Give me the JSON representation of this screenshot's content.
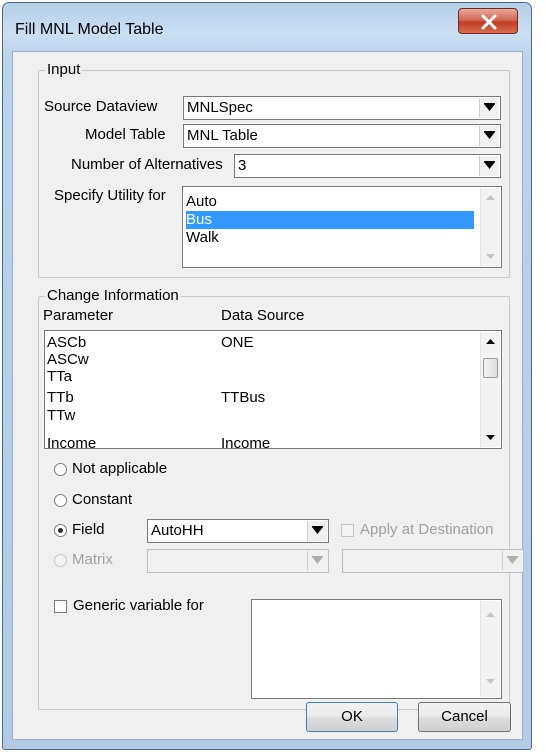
{
  "window": {
    "title": "Fill MNL Model Table",
    "close_icon": "close-icon"
  },
  "input_group": {
    "legend": "Input",
    "source_dataview": {
      "label": "Source Dataview",
      "value": "MNLSpec"
    },
    "model_table": {
      "label": "Model Table",
      "value": "MNL Table"
    },
    "num_alternatives": {
      "label": "Number of Alternatives",
      "value": "3"
    },
    "specify_utility": {
      "label": "Specify Utility for",
      "items": [
        "Auto",
        "Bus",
        "Walk"
      ],
      "selected": "Bus"
    }
  },
  "change_group": {
    "legend": "Change Information",
    "columns": {
      "parameter": "Parameter",
      "data_source": "Data Source"
    },
    "rows": [
      {
        "parameter": "ASCb",
        "data_source": "ONE"
      },
      {
        "parameter": "ASCw",
        "data_source": ""
      },
      {
        "parameter": "TTa",
        "data_source": ""
      },
      {
        "parameter": "TTb",
        "data_source": "TTBus"
      },
      {
        "parameter": "TTw",
        "data_source": ""
      },
      {
        "parameter": "Income",
        "data_source": "Income"
      }
    ],
    "options": {
      "not_applicable": "Not applicable",
      "constant": "Constant",
      "field": "Field",
      "field_value": "AutoHH",
      "apply_at_destination": "Apply at Destination",
      "matrix": "Matrix",
      "selected": "Field"
    },
    "generic_variable": {
      "label": "Generic variable for",
      "checked": false
    }
  },
  "buttons": {
    "ok": "OK",
    "cancel": "Cancel"
  }
}
